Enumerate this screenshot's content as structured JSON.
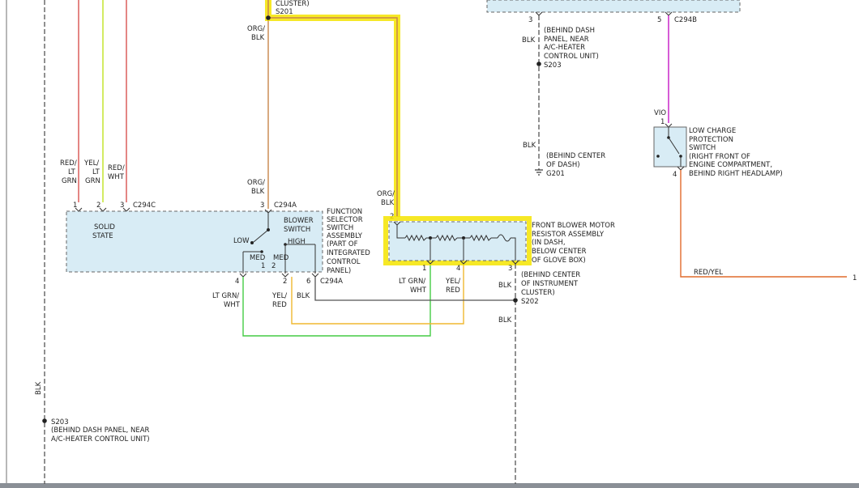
{
  "colors": {
    "red": "#d9534f",
    "yellow_green": "#c8e63c",
    "org_blk": "#c8864a",
    "highlight": "#f5e400",
    "blk": "#555555",
    "violet": "#cc33cc",
    "red_yel": "#e06a2a",
    "lt_grn": "#44cc44",
    "yel_red": "#f0b830",
    "component_fill": "#d8ecf5"
  },
  "top": {
    "cluster_fragment": "CLUSTER)",
    "s201": "S201",
    "org_blk_top": [
      "ORG/",
      "BLK"
    ],
    "pin3_left": "3",
    "pin5_right": "5",
    "c294b": "C294B",
    "dash_note": [
      "(BEHIND DASH",
      "PANEL, NEAR",
      "A/C-HEATER",
      "CONTROL UNIT)"
    ],
    "blk_a": "BLK",
    "s203_top": "S203",
    "blk_b": "BLK",
    "center_dash_note": [
      "(BEHIND CENTER",
      "OF DASH)"
    ],
    "g201": "G201",
    "vio": "VIO",
    "pin1_sw": "1",
    "pin4_sw": "4"
  },
  "low_charge": {
    "label": [
      "LOW CHARGE",
      "PROTECTION",
      "SWITCH",
      "(RIGHT FRONT OF",
      "ENGINE COMPARTMENT,",
      "BEHIND RIGHT HEADLAMP)"
    ],
    "red_yel": "RED/YEL",
    "end_pin": "1"
  },
  "left_wires": {
    "w1": [
      "RED/",
      "LT",
      "GRN"
    ],
    "w2": [
      "YEL/",
      "LT",
      "GRN"
    ],
    "w3": [
      "RED/",
      "WHT"
    ],
    "pins": [
      "1",
      "2",
      "3"
    ],
    "c294c": "C294C",
    "blk_vertical": "BLK",
    "s203_bottom": "S203",
    "s203_note": [
      "(BEHIND DASH PANEL, NEAR",
      "A/C-HEATER CONTROL UNIT)"
    ]
  },
  "function_selector": {
    "solid_state": [
      "SOLID",
      "STATE"
    ],
    "org_blk": [
      "ORG/",
      "BLK"
    ],
    "pin3": "3",
    "c294a_top": "C294A",
    "blower_switch": [
      "BLOWER",
      "SWITCH"
    ],
    "low": "LOW",
    "high": "HIGH",
    "med1": "MED",
    "med1_num": "1",
    "med2": "MED",
    "med2_num": "2",
    "label": [
      "FUNCTION",
      "SELECTOR",
      "SWITCH",
      "ASSEMBLY",
      "(PART OF",
      "INTEGRATED",
      "CONTROL",
      "PANEL)"
    ],
    "pins_bottom": [
      "4",
      "2",
      "6"
    ],
    "c294a_bottom": "C294A",
    "lt_grn_wht": [
      "LT GRN/",
      "WHT"
    ],
    "yel_red": [
      "YEL/",
      "RED"
    ],
    "blk": "BLK"
  },
  "resistor": {
    "org_blk": [
      "ORG/",
      "BLK"
    ],
    "pin2": "2",
    "label": [
      "FRONT BLOWER MOTOR",
      "RESISTOR ASSEMBLY",
      "(IN DASH,",
      "BELOW CENTER",
      "OF GLOVE BOX)"
    ],
    "pins_bottom": [
      "1",
      "4",
      "3"
    ],
    "lt_grn_wht": [
      "LT GRN/",
      "WHT"
    ],
    "yel_red": [
      "YEL/",
      "RED"
    ],
    "blk": "BLK",
    "instrument_note": [
      "(BEHIND CENTER",
      "OF INSTRUMENT",
      "CLUSTER)"
    ],
    "s202": "S202",
    "blk_down": "BLK"
  }
}
